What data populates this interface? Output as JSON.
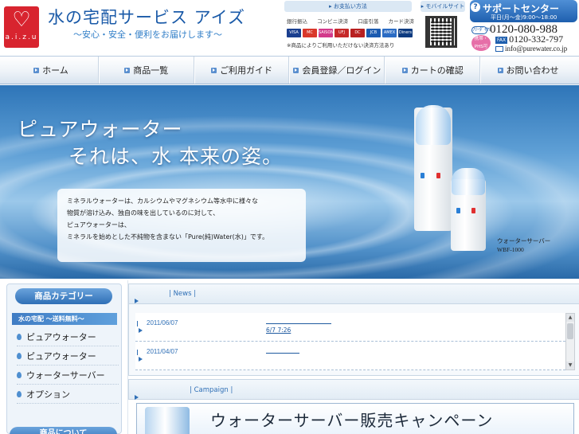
{
  "header": {
    "logo_word": "a.i.z.u",
    "site_title": "水の宅配サービス アイズ",
    "site_subtitle": "〜安心・安全・便利をお届けします〜"
  },
  "payment": {
    "tab_label": "お支払い方法",
    "methods": [
      "銀行振込",
      "コンビニ決済",
      "口座引落",
      "カード決済"
    ],
    "cards": [
      {
        "name": "VISA",
        "color": "#1a3f8f"
      },
      {
        "name": "MC",
        "color": "#d9382b"
      },
      {
        "name": "SAISON",
        "color": "#d23a8b"
      },
      {
        "name": "UFJ",
        "color": "#c62a2a"
      },
      {
        "name": "DC",
        "color": "#b82020"
      },
      {
        "name": "JCB",
        "color": "#1b5bb0"
      },
      {
        "name": "AMEX",
        "color": "#2b6cc4"
      },
      {
        "name": "Diners",
        "color": "#0d3b80"
      }
    ],
    "note": "※商品によりご利用いただけない決済方法あり"
  },
  "mobile": {
    "tab_label": "モバイルサイト"
  },
  "support": {
    "title": "サポートセンター",
    "hours": "平日(月〜金)9:00〜18:00",
    "tel_icon": "ﾌﾘｰﾀﾞｲﾔﾙ",
    "tel": "0120-080-988",
    "free_badge": "携帯・PHS可",
    "fax_label": "FAX",
    "fax": "0120-332-797",
    "email": "info@purewater.co.jp"
  },
  "nav": {
    "items": [
      "ホーム",
      "商品一覧",
      "ご利用ガイド",
      "会員登録／ログイン",
      "カートの確認",
      "お問い合わせ"
    ]
  },
  "hero": {
    "line1": "ピュアウォーター",
    "line2": "それは、水 本来の姿。",
    "desc": [
      "ミネラルウォーターは、カルシウムやマグネシウム等水中に様々な",
      "物質が溶け込み、独自の味を出しているのに対して、",
      "ピュアウォーターは、",
      "ミネラルを始めとした不純物を含まない「Pure(純)Water(水)」です。"
    ],
    "server_label": "ウォーターサーバー",
    "server_model": "WBF-1000"
  },
  "sidebar": {
    "category_heading": "商品カテゴリー",
    "band": "水の宅配 〜送料無料〜",
    "items": [
      "ピュアウォーター",
      "ピュアウォーター",
      "ウォーターサーバー",
      "オプション"
    ],
    "bottom_heading": "商品について"
  },
  "news": {
    "label": "| News |",
    "items": [
      {
        "date": "2011/06/07",
        "sub": "6/7 7:26"
      },
      {
        "date": "2011/04/07",
        "sub": ""
      }
    ]
  },
  "campaign": {
    "label": "| Campaign |",
    "banner_text": "ウォーターサーバー販売キャンペーン"
  }
}
